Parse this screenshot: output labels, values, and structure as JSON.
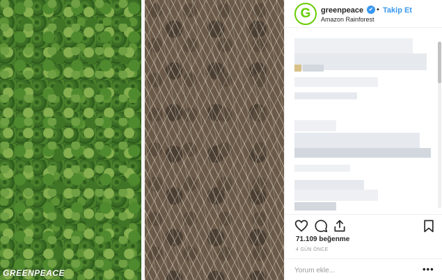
{
  "post": {
    "watermark": "GREENPEACE",
    "avatar_letter": "G",
    "username": "greenpeace",
    "verified_mark": "✔",
    "separator": "•",
    "follow_label": "Takip Et",
    "location": "Amazon Rainforest",
    "likes": "71.109 beğenme",
    "timestamp": "4 GÜN ÖNCE",
    "comment_placeholder": "Yorum ekle...",
    "more_label": "•••"
  },
  "colors": {
    "follow_blue": "#3897f0",
    "brand_green": "#66cc00"
  },
  "icons": [
    "heart-icon",
    "comment-icon",
    "share-icon",
    "bookmark-icon"
  ]
}
